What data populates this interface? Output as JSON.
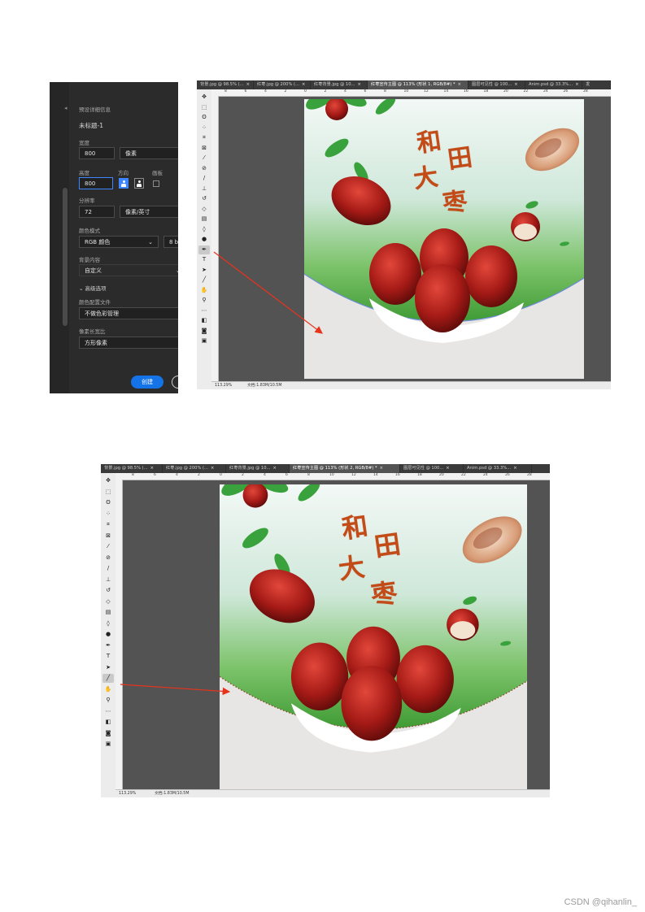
{
  "new_document": {
    "section_title": "预设详细信息",
    "doc_name": "未标题-1",
    "width_label": "宽度",
    "width_value": "800",
    "width_unit": "像素",
    "height_label": "高度",
    "height_value": "800",
    "orientation_label": "方向",
    "artboard_label": "画板",
    "resolution_label": "分辨率",
    "resolution_value": "72",
    "resolution_unit": "像素/英寸",
    "color_mode_label": "颜色模式",
    "color_mode_value": "RGB 颜色",
    "bit_depth_value": "8 b",
    "background_label": "背景内容",
    "background_value": "自定义",
    "advanced_label": "高级选项",
    "color_profile_label": "颜色配置文件",
    "color_profile_value": "不做色彩管理",
    "pixel_aspect_label": "像素长宽比",
    "pixel_aspect_value": "方形像素",
    "create_button": "创建"
  },
  "ps_top": {
    "tabs": [
      {
        "label": "背景.jpg @ 98.5% (..."
      },
      {
        "label": "红枣.jpg @ 200% (..."
      },
      {
        "label": "红枣背景.jpg @ 10..."
      },
      {
        "label": "红枣宣传主图 @ 113% (形状 1, RGB/8#) *"
      },
      {
        "label": "图层可见性 @ 100..."
      },
      {
        "label": "Anim.psd @ 33.3%..."
      },
      {
        "label": "发"
      }
    ],
    "active_tab": 3,
    "ruler_top": [
      "8",
      "6",
      "4",
      "2",
      "0",
      "2",
      "4",
      "6",
      "8",
      "10",
      "12",
      "14",
      "16",
      "18",
      "20",
      "22",
      "24",
      "26",
      "28"
    ],
    "status_zoom": "113.29%",
    "status_doc": "文档:1.83M/10.5M"
  },
  "ps_bottom": {
    "tabs": [
      {
        "label": "背景.jpg @ 98.5% (..."
      },
      {
        "label": "红枣.jpg @ 200% (..."
      },
      {
        "label": "红枣背景.jpg @ 10..."
      },
      {
        "label": "红枣宣传主图 @ 113% (形状 2, RGB/8#) *"
      },
      {
        "label": "图层可见性 @ 100..."
      },
      {
        "label": "Anim.psd @ 33.3%..."
      }
    ],
    "active_tab": 3,
    "ruler_top": [
      "8",
      "6",
      "4",
      "2",
      "0",
      "2",
      "4",
      "6",
      "8",
      "10",
      "12",
      "14",
      "16",
      "18",
      "20",
      "22",
      "24",
      "26",
      "28"
    ],
    "status_zoom": "113.29%",
    "status_doc": "文档:1.83M/10.5M"
  },
  "artwork": {
    "title_chars": [
      "和",
      "田",
      "大",
      "枣"
    ]
  },
  "tools": [
    "move-tool",
    "marquee-tool",
    "lasso-tool",
    "quick-select-tool",
    "crop-tool",
    "frame-tool",
    "eyedropper-tool",
    "healing-tool",
    "brush-tool",
    "stamp-tool",
    "history-brush-tool",
    "eraser-tool",
    "gradient-tool",
    "blur-tool",
    "dodge-tool",
    "pen-tool",
    "type-tool",
    "path-select-tool",
    "line-tool",
    "hand-tool",
    "zoom-tool",
    "more-tools",
    "colors",
    "quick-mask",
    "screen-mode"
  ],
  "colors": {
    "accent": "#1473e6",
    "arrow": "#e8331c",
    "title": "#c24b17"
  },
  "footer": "CSDN @qihanlin_"
}
